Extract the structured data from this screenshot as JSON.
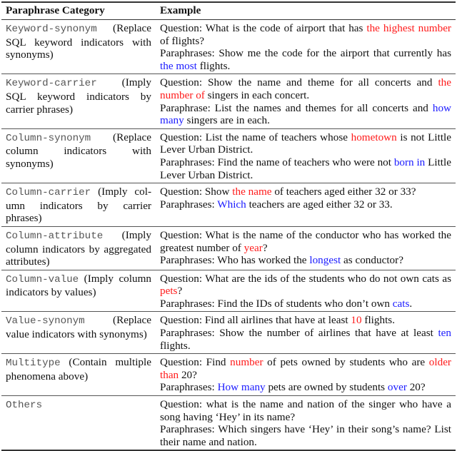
{
  "table": {
    "headers": [
      "Paraphrase Category",
      "Example"
    ],
    "colors": {
      "question_highlight": "#ff1a1a",
      "paraphrase_highlight": "#1a1aff"
    },
    "rows": [
      {
        "category_name": "Keyword-synonym",
        "category_desc": " (Replace SQL keyword indicators with synonyms)",
        "question": [
          {
            "t": "Question: What is the code of airport that has ",
            "h": ""
          },
          {
            "t": "the highest number",
            "h": "red"
          },
          {
            "t": " of flights?",
            "h": ""
          }
        ],
        "paraphrase": [
          {
            "t": "Paraphrases: Show me the code for the airport that currently has ",
            "h": ""
          },
          {
            "t": "the most",
            "h": "blue"
          },
          {
            "t": " flights.",
            "h": ""
          }
        ]
      },
      {
        "category_name": "Keyword-carrier",
        "category_desc": " (Imply SQL keyword indicators by carrier phrases)",
        "question": [
          {
            "t": "Question: Show the name and theme for all concerts and ",
            "h": ""
          },
          {
            "t": "the number of",
            "h": "red"
          },
          {
            "t": " singers in each concert.",
            "h": ""
          }
        ],
        "paraphrase": [
          {
            "t": "Paraphrase: List the names and themes for all concerts and ",
            "h": ""
          },
          {
            "t": "how many",
            "h": "blue"
          },
          {
            "t": " singers are in each.",
            "h": ""
          }
        ]
      },
      {
        "category_name": "Column-synonym",
        "category_desc": " (Replace column indicators with synonyms)",
        "question": [
          {
            "t": "Question: List the name of teachers whose ",
            "h": ""
          },
          {
            "t": "hometown",
            "h": "red"
          },
          {
            "t": " is not Little Lever Urban District.",
            "h": ""
          }
        ],
        "paraphrase": [
          {
            "t": "Paraphrases: Find the name of teachers who were not ",
            "h": ""
          },
          {
            "t": "born in",
            "h": "blue"
          },
          {
            "t": " Little Lever Urban District.",
            "h": ""
          }
        ]
      },
      {
        "category_name": "Column-carrier",
        "category_desc": " (Imply col­umn indicators by carrier phrases)",
        "question": [
          {
            "t": "Question: Show ",
            "h": ""
          },
          {
            "t": "the name",
            "h": "red"
          },
          {
            "t": " of teachers aged either 32 or 33?",
            "h": ""
          }
        ],
        "paraphrase": [
          {
            "t": "Paraphrases: ",
            "h": ""
          },
          {
            "t": "Which",
            "h": "blue"
          },
          {
            "t": " teachers are aged either 32 or 33.",
            "h": ""
          }
        ]
      },
      {
        "category_name": "Column-attribute",
        "category_desc": " (Imply column indicators by aggregated attributes)",
        "question": [
          {
            "t": "Question: What is the name of the conductor who has worked the great­est number of ",
            "h": ""
          },
          {
            "t": "year",
            "h": "red"
          },
          {
            "t": "?",
            "h": ""
          }
        ],
        "paraphrase": [
          {
            "t": "Paraphrases: Who has worked the ",
            "h": ""
          },
          {
            "t": "longest",
            "h": "blue"
          },
          {
            "t": " as conductor?",
            "h": ""
          }
        ]
      },
      {
        "category_name": "Column-value",
        "category_desc": " (Imply column indicators by values)",
        "question": [
          {
            "t": "Question: What are the ids of the students who do not own cats as ",
            "h": ""
          },
          {
            "t": "pets",
            "h": "red"
          },
          {
            "t": "?",
            "h": ""
          }
        ],
        "paraphrase": [
          {
            "t": "Paraphrases: Find the IDs of students who don’t own ",
            "h": ""
          },
          {
            "t": "cats",
            "h": "blue"
          },
          {
            "t": ".",
            "h": ""
          }
        ]
      },
      {
        "category_name": "Value-synonym",
        "category_desc": " (Replace value indicators with synonyms)",
        "question": [
          {
            "t": "Question: Find all airlines that have at least ",
            "h": ""
          },
          {
            "t": "10",
            "h": "red"
          },
          {
            "t": " flights.",
            "h": ""
          }
        ],
        "paraphrase": [
          {
            "t": "Paraphrases: Show the number of airlines that have at least ",
            "h": ""
          },
          {
            "t": "ten",
            "h": "blue"
          },
          {
            "t": " flights.",
            "h": ""
          }
        ]
      },
      {
        "category_name": "Multitype",
        "category_desc": " (Contain multiple phenomena above)",
        "question": [
          {
            "t": "Question: Find ",
            "h": ""
          },
          {
            "t": "number",
            "h": "red"
          },
          {
            "t": " of pets owned by students who are ",
            "h": ""
          },
          {
            "t": "older than",
            "h": "red"
          },
          {
            "t": " 20?",
            "h": ""
          }
        ],
        "paraphrase": [
          {
            "t": "Paraphrases: ",
            "h": ""
          },
          {
            "t": "How many",
            "h": "blue"
          },
          {
            "t": " pets are owned by students ",
            "h": ""
          },
          {
            "t": "over",
            "h": "blue"
          },
          {
            "t": " 20?",
            "h": ""
          }
        ]
      },
      {
        "category_name": "Others",
        "category_desc": "",
        "question": [
          {
            "t": "Question: what is the name and nation of the singer who have a song having ‘Hey’ in its name?",
            "h": ""
          }
        ],
        "paraphrase": [
          {
            "t": "Paraphrases: Which singers have ‘Hey’ in their song’s name? List their name and nation.",
            "h": ""
          }
        ]
      }
    ]
  }
}
